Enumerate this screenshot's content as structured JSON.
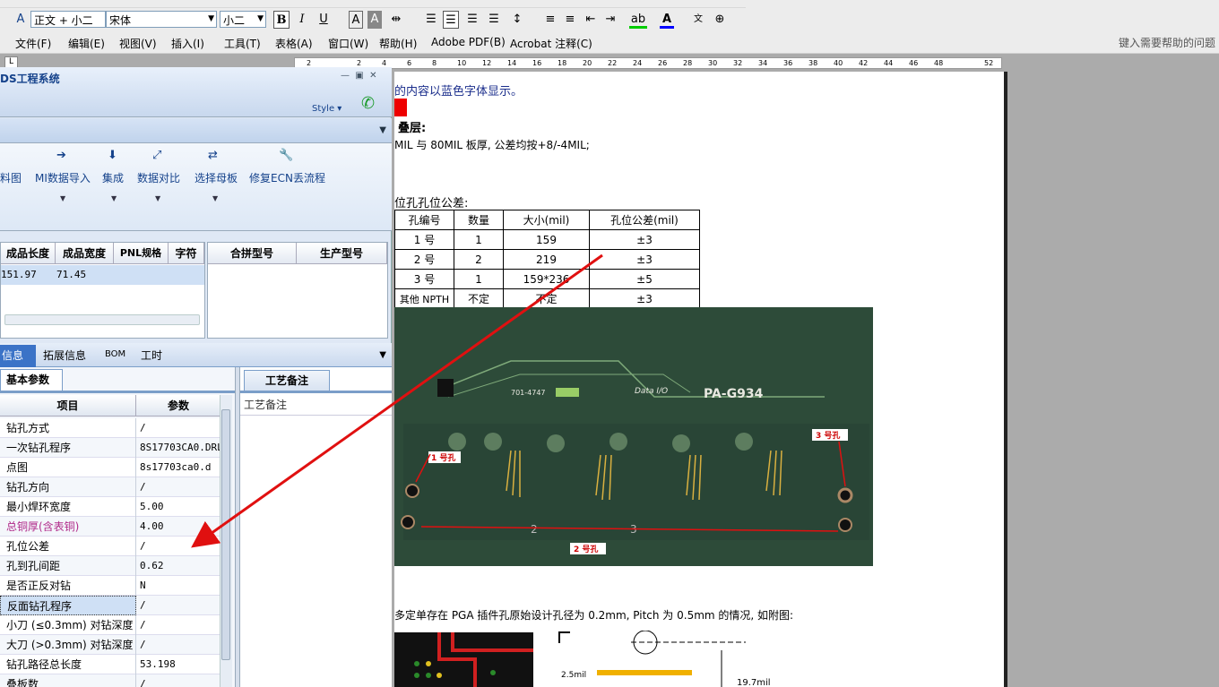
{
  "word": {
    "style_box": "正文 + 小二",
    "font_box": "宋体",
    "size_box": "小二",
    "bold": "B",
    "italic": "I",
    "underline": "U",
    "font_a": "A",
    "menus": [
      "文件(F)",
      "编辑(E)",
      "视图(V)",
      "插入(I)",
      "工具(T)",
      "表格(A)",
      "窗口(W)",
      "帮助(H)",
      "Adobe PDF(B)",
      "Acrobat 注释(C)"
    ],
    "help_placeholder": "键入需要帮助的问题",
    "ruler_ticks": [
      "2",
      "2",
      "4",
      "6",
      "8",
      "10",
      "12",
      "14",
      "16",
      "18",
      "20",
      "22",
      "24",
      "26",
      "28",
      "30",
      "32",
      "34",
      "36",
      "38",
      "40",
      "42",
      "44",
      "46",
      "48",
      "52"
    ]
  },
  "doc": {
    "line1": "的内容以蓝色字体显示。",
    "heading_stack": "叠层:",
    "line_thickness": "MIL 与 80MIL 板厚, 公差均按+8/-4MIL;",
    "line_hole_tol": "位孔孔位公差:",
    "table_headers": [
      "孔编号",
      "数量",
      "大小(mil)",
      "孔位公差(mil)"
    ],
    "table_rows": [
      [
        "1 号",
        "1",
        "159",
        "±3"
      ],
      [
        "2 号",
        "2",
        "219",
        "±3"
      ],
      [
        "3 号",
        "1",
        "159*236",
        "±5"
      ],
      [
        "其他 NPTH",
        "不定",
        "不定",
        "±3"
      ]
    ],
    "photo_labels": {
      "hole1": "1 号孔",
      "hole2": "2 号孔",
      "hole3": "3 号孔",
      "part": "PA-G934",
      "code": "701-4747",
      "num2": "2",
      "num3": "3",
      "brand": "Data I/O"
    },
    "line_pga": "多定单存在 PGA 插件孔原始设计孔径为 0.2mm, Pitch 为 0.5mm 的情况, 如附图:",
    "diag_label1": "2.5mil",
    "diag_label2": "19.7mil"
  },
  "app": {
    "title": "DS工程系统",
    "style_label": "Style",
    "ribbon": [
      "料图",
      "MI数据导入",
      "集成",
      "数据对比",
      "选择母板",
      "修复ECN丢流程"
    ],
    "grid1_headers": [
      "成品长度",
      "成品宽度",
      "PNL规格",
      "字符"
    ],
    "grid1_row": [
      "151.97",
      "71.45",
      "",
      ""
    ],
    "grid2_headers": [
      "合拼型号",
      "生产型号"
    ],
    "tabs": [
      "信息",
      "拓展信息",
      "BOM",
      "工时"
    ],
    "basic_tab": "基本参数",
    "param_headers": [
      "项目",
      "参数"
    ],
    "params": [
      {
        "k": "钻孔方式",
        "v": "/"
      },
      {
        "k": "一次钻孔程序",
        "v": "8S17703CA0.DRL"
      },
      {
        "k": "点图",
        "v": "8s17703ca0.d"
      },
      {
        "k": "钻孔方向",
        "v": "/"
      },
      {
        "k": "最小焊环宽度",
        "v": "5.00"
      },
      {
        "k": "总铜厚(含表铜)",
        "v": "4.00"
      },
      {
        "k": "孔位公差",
        "v": "/"
      },
      {
        "k": "孔到孔间距",
        "v": "0.62"
      },
      {
        "k": "是否正反对钻",
        "v": "N"
      },
      {
        "k": "反面钻孔程序",
        "v": "/"
      },
      {
        "k": "小刀 (≤0.3mm) 对钻深度",
        "v": "/"
      },
      {
        "k": "大刀 (>0.3mm) 对钻深度",
        "v": "/"
      },
      {
        "k": "钻孔路径总长度",
        "v": "53.198"
      },
      {
        "k": "叠板数",
        "v": "/"
      }
    ],
    "note_tab": "工艺备注",
    "note_label": "工艺备注"
  },
  "colors": {
    "accent": "#3b73c7",
    "highlight_param": "#b02a8a",
    "arrow": "#e01010"
  }
}
